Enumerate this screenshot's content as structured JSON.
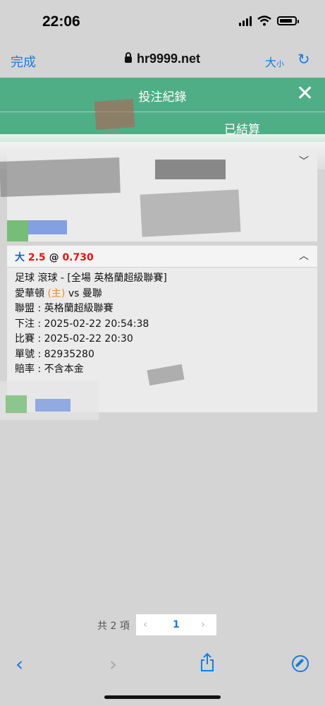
{
  "status_bar": {
    "time": "22:06"
  },
  "browser": {
    "done_label": "完成",
    "url": "hr9999.net",
    "text_size_label": "大",
    "text_size_small": "小"
  },
  "modal": {
    "title": "投注紀錄",
    "tab_settled": "已結算"
  },
  "bets": [
    {
      "selection": "大",
      "line": "2.5",
      "at": "@",
      "odds": "0.730",
      "line1": "足球 滾球 - [全場 英格蘭超級聯賽]",
      "home_team": "愛華頓",
      "home_marker": "(主)",
      "vs": "vs",
      "away_team": "曼聯",
      "league_line": "聯盟 : 英格蘭超級聯賽",
      "bet_time_line": "下注 : 2025-02-22 20:54:38",
      "match_time_line": "比賽 : 2025-02-22 20:30",
      "ticket_line": "單號 : 82935280",
      "odds_type_line": "賠率 : 不含本金"
    }
  ],
  "pagination": {
    "total": "共 2 項",
    "current_page": "1"
  },
  "colors": {
    "header_green": "#4fae86",
    "link_blue": "#1a7be0",
    "odds_red": "#e11111",
    "home_orange": "#f08a1d"
  }
}
